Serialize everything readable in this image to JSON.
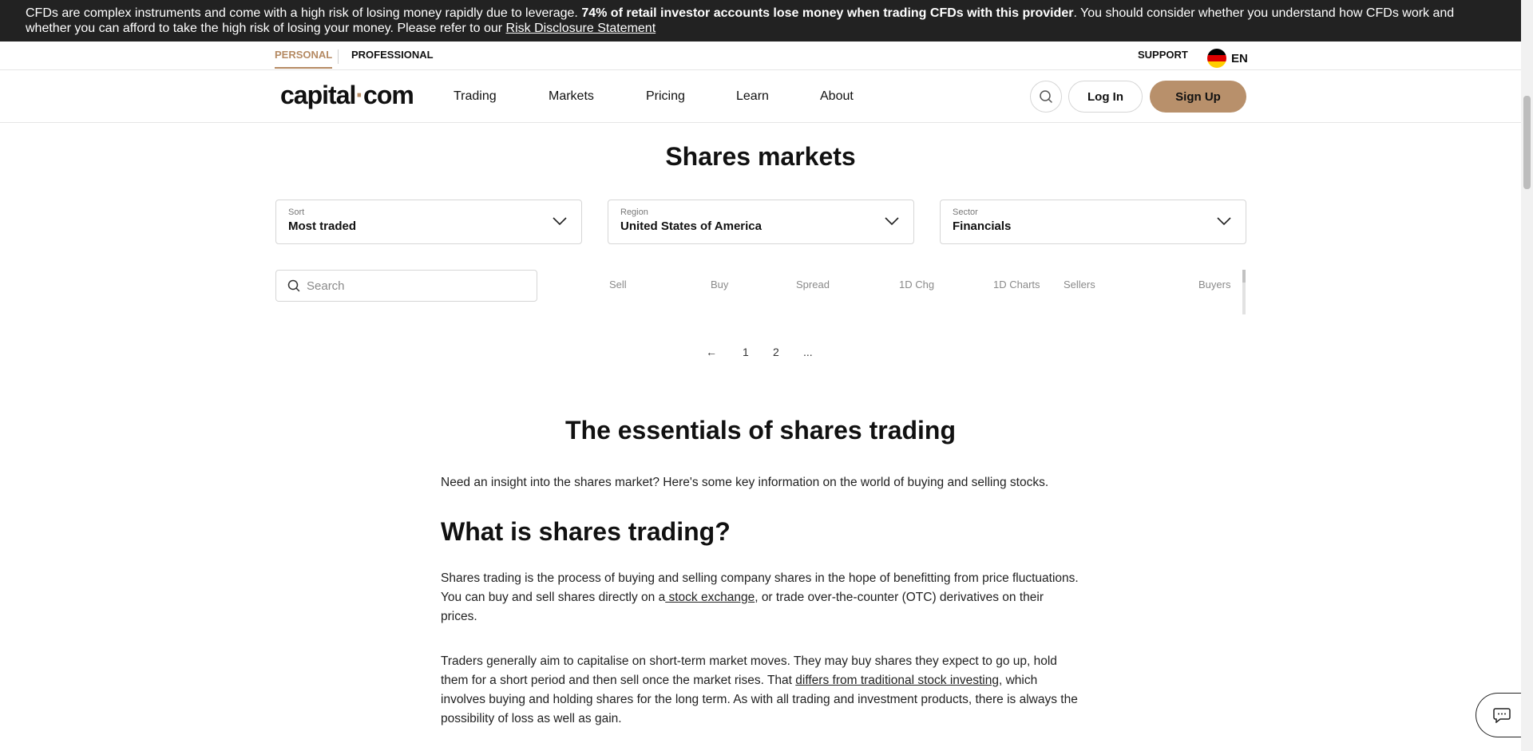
{
  "risk_banner": {
    "text_before": "CFDs are complex instruments and come with a high risk of losing money rapidly due to leverage. ",
    "text_bold": "74% of retail investor accounts lose money when trading CFDs with this provider",
    "text_after": ". You should consider whether you understand how CFDs work and whether you can afford to take the high risk of losing your money. Please refer to our ",
    "link": "Risk Disclosure Statement"
  },
  "topbar": {
    "personal": "PERSONAL",
    "professional": "PROFESSIONAL",
    "support": "SUPPORT",
    "language": "EN"
  },
  "nav": {
    "logo_left": "capital",
    "logo_dot": "·",
    "logo_right": "com",
    "items": [
      "Trading",
      "Markets",
      "Pricing",
      "Learn",
      "About"
    ],
    "login": "Log In",
    "signup": "Sign Up"
  },
  "page_title": "Shares markets",
  "filters": {
    "sort": {
      "label": "Sort",
      "value": "Most traded"
    },
    "region": {
      "label": "Region",
      "value": "United States of America"
    },
    "sector": {
      "label": "Sector",
      "value": "Financials"
    }
  },
  "search": {
    "placeholder": "Search"
  },
  "table_headers": [
    "Sell",
    "Buy",
    "Spread",
    "1D Chg",
    "1D Charts",
    "Sellers",
    "Buyers"
  ],
  "pagination": {
    "prev": "←",
    "pages": [
      "1",
      "2",
      "..."
    ]
  },
  "article": {
    "title": "The essentials of shares trading",
    "intro": "Need an insight into the shares market? Here's some key information on the world of buying and selling stocks.",
    "section_title": "What is shares trading?",
    "p1_before": "Shares trading is the process of buying and selling company shares in the hope of benefitting from price fluctuations. You can buy and sell shares directly on a",
    "p1_link": " stock exchange",
    "p1_after": ", or trade over-the-counter (OTC) derivatives on their prices.",
    "p2_before": "Traders generally aim to capitalise on short-term market moves. They may buy shares they expect to go up, hold them for a short period and then sell once the market rises. That ",
    "p2_link": "differs from traditional stock investing",
    "p2_after": ", which involves buying and holding shares for the long term. As with all trading and investment products, there is always the possibility of loss as well as gain."
  },
  "colors": {
    "accent": "#b58a63",
    "signup_bg": "#b8906b",
    "banner_bg": "#222222"
  },
  "icons": {
    "search": "search-icon",
    "chevron": "chevron-down-icon",
    "flag": "germany-flag-icon",
    "chat": "chat-icon"
  }
}
